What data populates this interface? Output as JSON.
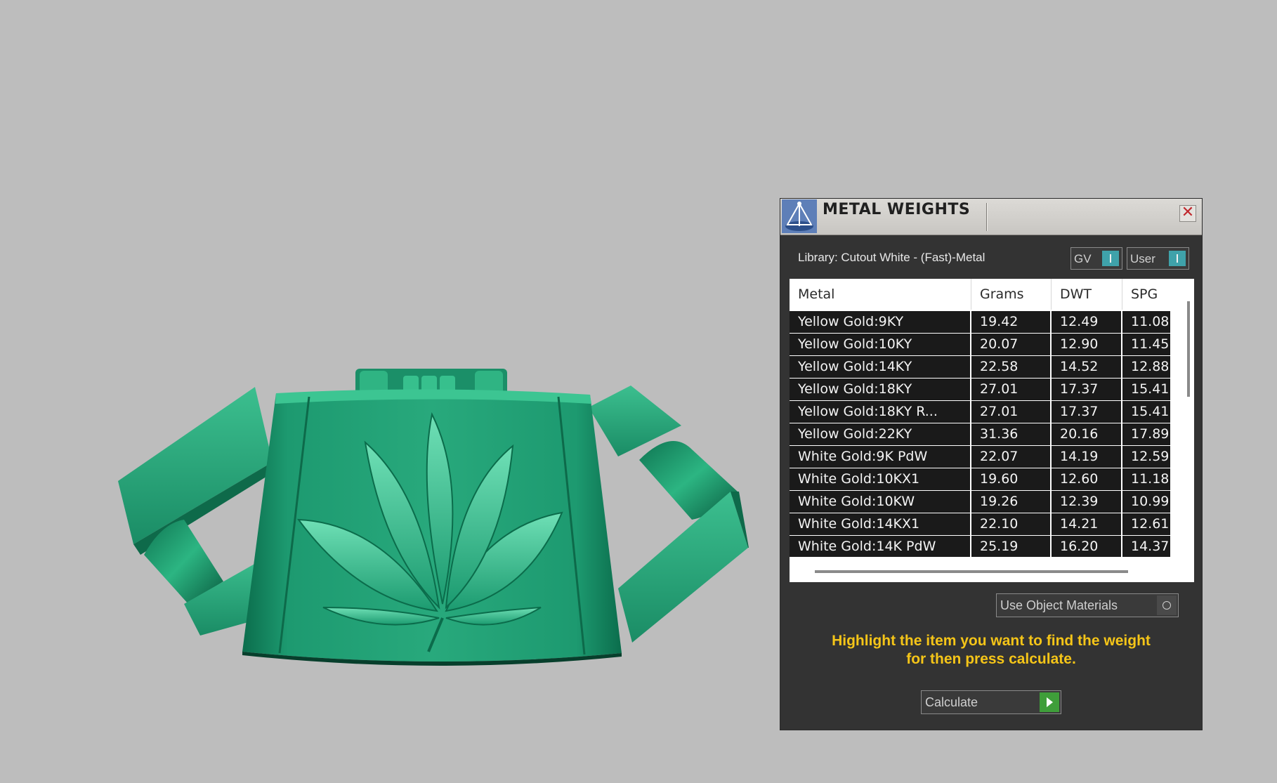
{
  "panel": {
    "title": "METAL WEIGHTS",
    "close_icon": "close-icon",
    "close_glyph": "✕",
    "library_label": "Library: Cutout White - (Fast)-Metal",
    "toggles": {
      "gv_label": "GV",
      "user_label": "User"
    },
    "table": {
      "columns": [
        "Metal",
        "Grams",
        "DWT",
        "SPG"
      ],
      "rows": [
        [
          "Yellow Gold:9KY",
          "19.42",
          "12.49",
          "11.08"
        ],
        [
          "Yellow Gold:10KY",
          "20.07",
          "12.90",
          "11.45"
        ],
        [
          "Yellow Gold:14KY",
          "22.58",
          "14.52",
          "12.88"
        ],
        [
          "Yellow Gold:18KY",
          "27.01",
          "17.37",
          "15.41"
        ],
        [
          "Yellow Gold:18KY R...",
          "27.01",
          "17.37",
          "15.41"
        ],
        [
          "Yellow Gold:22KY",
          "31.36",
          "20.16",
          "17.89"
        ],
        [
          "White Gold:9K PdW",
          "22.07",
          "14.19",
          "12.59"
        ],
        [
          "White Gold:10KX1",
          "19.60",
          "12.60",
          "11.18"
        ],
        [
          "White Gold:10KW",
          "19.26",
          "12.39",
          "10.99"
        ],
        [
          "White Gold:14KX1",
          "22.10",
          "14.21",
          "12.61"
        ],
        [
          "White Gold:14K PdW",
          "25.19",
          "16.20",
          "14.37"
        ]
      ]
    },
    "use_object_materials_label": "Use Object Materials",
    "hint_line1": "Highlight the item you want to find the weight",
    "hint_line2": "for then press calculate.",
    "calculate_label": "Calculate"
  },
  "colors": {
    "viewport_bg": "#bdbdbd",
    "panel_bg": "#333333",
    "model_green": "#1f9a72",
    "hint_yellow": "#f5c518",
    "toggle_teal": "#3fa2aa",
    "calculate_green": "#3f9e3a"
  }
}
